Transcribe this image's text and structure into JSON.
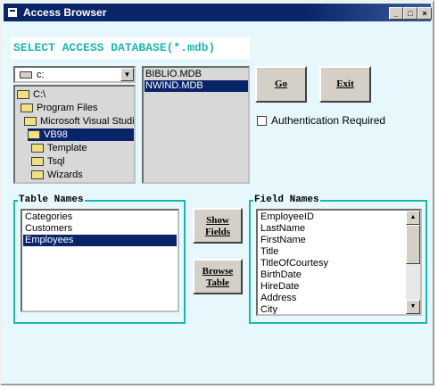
{
  "window": {
    "title": "Access Browser",
    "controls": {
      "minimize": "_",
      "maximize": "□",
      "close": "×"
    }
  },
  "heading": "SELECT ACCESS DATABASE(*.mdb)",
  "drive": {
    "value": "c:"
  },
  "directories": [
    {
      "label": "C:\\",
      "icon": "open-folder-icon"
    },
    {
      "label": "Program Files",
      "icon": "open-folder-icon"
    },
    {
      "label": "Microsoft Visual Studio",
      "icon": "open-folder-icon"
    },
    {
      "label": "VB98",
      "icon": "open-folder-icon",
      "selected": true
    },
    {
      "label": "Template",
      "icon": "folder-icon"
    },
    {
      "label": "Tsql",
      "icon": "folder-icon"
    },
    {
      "label": "Wizards",
      "icon": "folder-icon"
    }
  ],
  "files": [
    {
      "label": "BIBLIO.MDB"
    },
    {
      "label": "NWIND.MDB",
      "selected": true
    }
  ],
  "buttons": {
    "go": "Go",
    "exit": "Exit",
    "show_fields_1": "Show",
    "show_fields_2": "Fields",
    "browse_table_1": "Browse",
    "browse_table_2": "Table"
  },
  "auth": {
    "label": "Authentication Required",
    "checked": false
  },
  "table_names": {
    "legend": "Table Names",
    "items": [
      "Categories",
      "Customers",
      "Employees"
    ],
    "selected_index": 2
  },
  "field_names": {
    "legend": "Field Names",
    "items": [
      "EmployeeID",
      "LastName",
      "FirstName",
      "Title",
      "TitleOfCourtesy",
      "BirthDate",
      "HireDate",
      "Address",
      "City"
    ]
  },
  "colors": {
    "accent": "#1fb4b4",
    "selection": "#0a246a",
    "titlebar": "#0a246a"
  }
}
